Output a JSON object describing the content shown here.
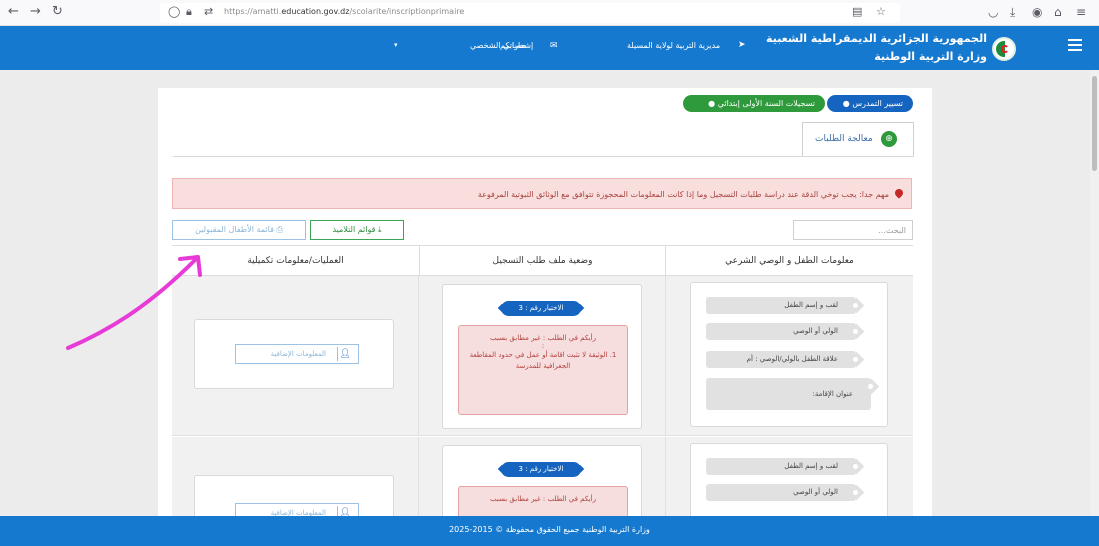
{
  "browser": {
    "url": "https://amatti.education.gov.dz/scolarite/inscriptionprimaire",
    "url_prefix": "https://amatti.",
    "url_domain": "education.gov.dz",
    "url_path": "/scolarite/inscriptionprimaire"
  },
  "header": {
    "country_name": "الجمهورية الجزائرية الديمقراطية الشعبية",
    "ministry_name": "وزارة التربية الوطنية",
    "directorate": "مديرية التربية لولاية المسيلة",
    "notifications": "إشعاراتكم",
    "my_account": "حسابي الشخصي"
  },
  "breadcrumb": {
    "item1": "تسيير التمدرس",
    "item2": "تسجيلات السنة الأولى إبتدائي"
  },
  "tab": {
    "label": "معالجة الطلبات"
  },
  "alert": {
    "text": "مهم جدا: يجب توخي الدقة عند دراسة طلبات التسجيل وما إذا كانت المعلومات المحجوزة تتوافق مع الوثائق الثبوتية المرفوعة"
  },
  "search": {
    "placeholder": "البحث..."
  },
  "buttons": {
    "student_lists": "قوائم التلاميذ",
    "accepted_list": "قائمة الأطفال المقبولين"
  },
  "table": {
    "columns": [
      "معلومات الطفل و الوصي الشرعي",
      "وضعية ملف طلب التسجيل",
      "العمليات/معلومات تكميلية"
    ],
    "rows": [
      {
        "child_fields": [
          "لقب و إسم الطفل",
          "الولي أو الوصي",
          "علاقة الطفل بالولي/الوصي : أم",
          "عنوان الإقامة:"
        ],
        "choice_badge": "الاختيار رقم : 3",
        "status_head": "رأيكم في الطلب : غير مطابق بسبب",
        "status_dot": ":",
        "status_item": "1.  الوثيقة لا تثبت اقامة أو عمل في حدود المقاطعة الجغرافية للمدرسة",
        "extra_button": "المعلومات الإضافية"
      },
      {
        "child_fields": [
          "لقب و إسم الطفل",
          "الولي أو الوصي"
        ],
        "choice_badge": "الاختيار رقم : 3",
        "status_head": "رأيكم في الطلب : غير مطابق بسبب",
        "extra_button": "المعلومات الإضافية"
      }
    ]
  },
  "footer": {
    "text": "وزارة التربية الوطنية جميع الحقوق محفوظة © 2015-2025"
  },
  "colors": {
    "header_blue": "#1579cf",
    "breadcrumb_blue": "#1565c0",
    "breadcrumb_green": "#2e9a3b",
    "alert_bg": "#f9dede",
    "annotation_arrow": "#e83ad6"
  },
  "icons": {
    "menu": "hamburger-icon",
    "logo": "algeria-emblem-icon",
    "alert": "map-pin-icon",
    "tab": "pin-icon",
    "download": "download-icon",
    "print": "print-icon",
    "add_user": "add-user-icon"
  }
}
